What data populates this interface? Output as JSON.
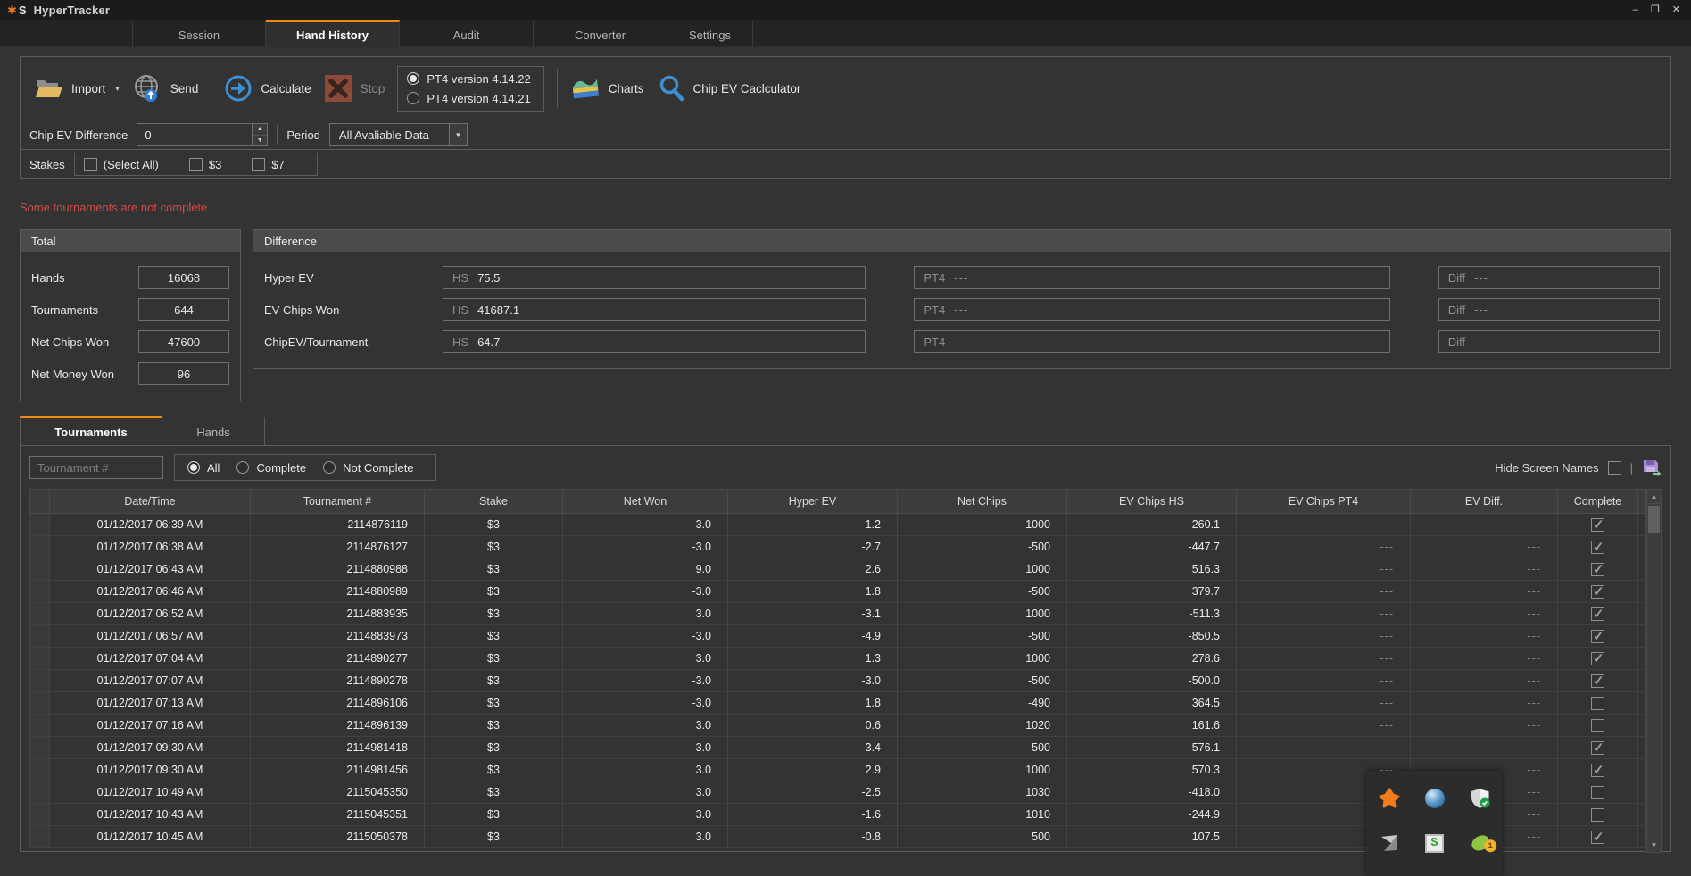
{
  "window": {
    "title": "HyperTracker",
    "controls": {
      "minimize": "–",
      "restore": "❐",
      "close": "✕"
    }
  },
  "tabs": [
    {
      "label": "Session",
      "active": false
    },
    {
      "label": "Hand History",
      "active": true
    },
    {
      "label": "Audit",
      "active": false
    },
    {
      "label": "Converter",
      "active": false
    },
    {
      "label": "Settings",
      "active": false
    }
  ],
  "toolbar": {
    "import_label": "Import",
    "send_label": "Send",
    "calculate_label": "Calculate",
    "stop_label": "Stop",
    "pt4_options": [
      {
        "label": "PT4 version 4.14.22",
        "selected": true
      },
      {
        "label": "PT4 version 4.14.21",
        "selected": false
      }
    ],
    "charts_label": "Charts",
    "chip_ev_label": "Chip EV Caclculator"
  },
  "filters": {
    "chip_ev_label": "Chip EV Difference",
    "chip_ev_value": "0",
    "period_label": "Period",
    "period_value": "All Avaliable Data",
    "stakes_label": "Stakes",
    "stakes_options": [
      {
        "label": "(Select All)",
        "checked": false
      },
      {
        "label": "$3",
        "checked": false
      },
      {
        "label": "$7",
        "checked": false
      }
    ]
  },
  "warning": "Some tournaments are not complete.",
  "total": {
    "header": "Total",
    "rows": [
      {
        "label": "Hands",
        "value": "16068"
      },
      {
        "label": "Tournaments",
        "value": "644"
      },
      {
        "label": "Net Chips Won",
        "value": "47600"
      },
      {
        "label": "Net Money Won",
        "value": "96"
      }
    ]
  },
  "difference": {
    "header": "Difference",
    "hs_prefix": "HS",
    "pt4_prefix": "PT4",
    "diff_prefix": "Diff",
    "empty_value": "---",
    "rows": [
      {
        "label": "Hyper EV",
        "hs": "75.5",
        "pt4": "---",
        "diff": "---"
      },
      {
        "label": "EV Chips Won",
        "hs": "41687.1",
        "pt4": "---",
        "diff": "---"
      },
      {
        "label": "ChipEV/Tournament",
        "hs": "64.7",
        "pt4": "---",
        "diff": "---"
      }
    ]
  },
  "subtabs": [
    {
      "label": "Tournaments",
      "active": true
    },
    {
      "label": "Hands",
      "active": false
    }
  ],
  "table_filter": {
    "search_placeholder": "Tournament #",
    "radios": [
      {
        "label": "All",
        "selected": true
      },
      {
        "label": "Complete",
        "selected": false
      },
      {
        "label": "Not Complete",
        "selected": false
      }
    ],
    "hide_screen_names_label": "Hide Screen Names",
    "hide_screen_names_checked": false,
    "separator": "|"
  },
  "table": {
    "columns": [
      "",
      "Date/Time",
      "Tournament #",
      "Stake",
      "Net Won",
      "Hyper EV",
      "Net Chips",
      "EV Chips HS",
      "EV Chips PT4",
      "EV Diff.",
      "Complete"
    ],
    "rows": [
      {
        "date": "01/12/2017 06:39 AM",
        "tournament": "2114876119",
        "stake": "$3",
        "net_won": "-3.0",
        "hyper_ev": "1.2",
        "net_chips": "1000",
        "ev_chips_hs": "260.1",
        "ev_chips_pt4": "---",
        "ev_diff": "---",
        "complete": true
      },
      {
        "date": "01/12/2017 06:38 AM",
        "tournament": "2114876127",
        "stake": "$3",
        "net_won": "-3.0",
        "hyper_ev": "-2.7",
        "net_chips": "-500",
        "ev_chips_hs": "-447.7",
        "ev_chips_pt4": "---",
        "ev_diff": "---",
        "complete": true
      },
      {
        "date": "01/12/2017 06:43 AM",
        "tournament": "2114880988",
        "stake": "$3",
        "net_won": "9.0",
        "hyper_ev": "2.6",
        "net_chips": "1000",
        "ev_chips_hs": "516.3",
        "ev_chips_pt4": "---",
        "ev_diff": "---",
        "complete": true
      },
      {
        "date": "01/12/2017 06:46 AM",
        "tournament": "2114880989",
        "stake": "$3",
        "net_won": "-3.0",
        "hyper_ev": "1.8",
        "net_chips": "-500",
        "ev_chips_hs": "379.7",
        "ev_chips_pt4": "---",
        "ev_diff": "---",
        "complete": true
      },
      {
        "date": "01/12/2017 06:52 AM",
        "tournament": "2114883935",
        "stake": "$3",
        "net_won": "3.0",
        "hyper_ev": "-3.1",
        "net_chips": "1000",
        "ev_chips_hs": "-511.3",
        "ev_chips_pt4": "---",
        "ev_diff": "---",
        "complete": true
      },
      {
        "date": "01/12/2017 06:57 AM",
        "tournament": "2114883973",
        "stake": "$3",
        "net_won": "-3.0",
        "hyper_ev": "-4.9",
        "net_chips": "-500",
        "ev_chips_hs": "-850.5",
        "ev_chips_pt4": "---",
        "ev_diff": "---",
        "complete": true
      },
      {
        "date": "01/12/2017 07:04 AM",
        "tournament": "2114890277",
        "stake": "$3",
        "net_won": "3.0",
        "hyper_ev": "1.3",
        "net_chips": "1000",
        "ev_chips_hs": "278.6",
        "ev_chips_pt4": "---",
        "ev_diff": "---",
        "complete": true
      },
      {
        "date": "01/12/2017 07:07 AM",
        "tournament": "2114890278",
        "stake": "$3",
        "net_won": "-3.0",
        "hyper_ev": "-3.0",
        "net_chips": "-500",
        "ev_chips_hs": "-500.0",
        "ev_chips_pt4": "---",
        "ev_diff": "---",
        "complete": true
      },
      {
        "date": "01/12/2017 07:13 AM",
        "tournament": "2114896106",
        "stake": "$3",
        "net_won": "-3.0",
        "hyper_ev": "1.8",
        "net_chips": "-490",
        "ev_chips_hs": "364.5",
        "ev_chips_pt4": "---",
        "ev_diff": "---",
        "complete": false
      },
      {
        "date": "01/12/2017 07:16 AM",
        "tournament": "2114896139",
        "stake": "$3",
        "net_won": "3.0",
        "hyper_ev": "0.6",
        "net_chips": "1020",
        "ev_chips_hs": "161.6",
        "ev_chips_pt4": "---",
        "ev_diff": "---",
        "complete": false
      },
      {
        "date": "01/12/2017 09:30 AM",
        "tournament": "2114981418",
        "stake": "$3",
        "net_won": "-3.0",
        "hyper_ev": "-3.4",
        "net_chips": "-500",
        "ev_chips_hs": "-576.1",
        "ev_chips_pt4": "---",
        "ev_diff": "---",
        "complete": true
      },
      {
        "date": "01/12/2017 09:30 AM",
        "tournament": "2114981456",
        "stake": "$3",
        "net_won": "3.0",
        "hyper_ev": "2.9",
        "net_chips": "1000",
        "ev_chips_hs": "570.3",
        "ev_chips_pt4": "---",
        "ev_diff": "---",
        "complete": true
      },
      {
        "date": "01/12/2017 10:49 AM",
        "tournament": "2115045350",
        "stake": "$3",
        "net_won": "3.0",
        "hyper_ev": "-2.5",
        "net_chips": "1030",
        "ev_chips_hs": "-418.0",
        "ev_chips_pt4": "---",
        "ev_diff": "---",
        "complete": false
      },
      {
        "date": "01/12/2017 10:43 AM",
        "tournament": "2115045351",
        "stake": "$3",
        "net_won": "3.0",
        "hyper_ev": "-1.6",
        "net_chips": "1010",
        "ev_chips_hs": "-244.9",
        "ev_chips_pt4": "---",
        "ev_diff": "---",
        "complete": false
      },
      {
        "date": "01/12/2017 10:45 AM",
        "tournament": "2115050378",
        "stake": "$3",
        "net_won": "3.0",
        "hyper_ev": "-0.8",
        "net_chips": "500",
        "ev_chips_hs": "107.5",
        "ev_chips_pt4": "---",
        "ev_diff": "---",
        "complete": true
      }
    ]
  },
  "tray_icons": [
    {
      "name": "avast"
    },
    {
      "name": "blue-sphere"
    },
    {
      "name": "defender-shield"
    },
    {
      "name": "gray-arrow"
    },
    {
      "name": "green-s"
    },
    {
      "name": "notification-blob"
    }
  ],
  "colors": {
    "accent_orange": "#ef8d12",
    "warning_red": "#d24a4a",
    "action_blue": "#3d8fd1",
    "stop_red": "#8e4a38"
  }
}
